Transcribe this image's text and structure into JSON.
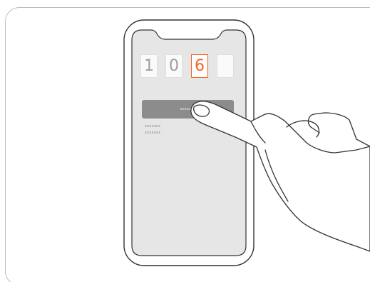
{
  "code_input": {
    "digits": [
      "1",
      "0",
      "6",
      ""
    ],
    "active_index": 2,
    "active_color": "#f26522"
  },
  "confirm_button": {
    "label": "xxxxxxx"
  },
  "hints": [
    "xxxxxxx",
    "xxxxxxx"
  ],
  "icons": {
    "hand": "finger-tap-icon"
  },
  "colors": {
    "screen": "#e6e6e6",
    "button": "#8c8c8c",
    "outline": "#333333"
  }
}
